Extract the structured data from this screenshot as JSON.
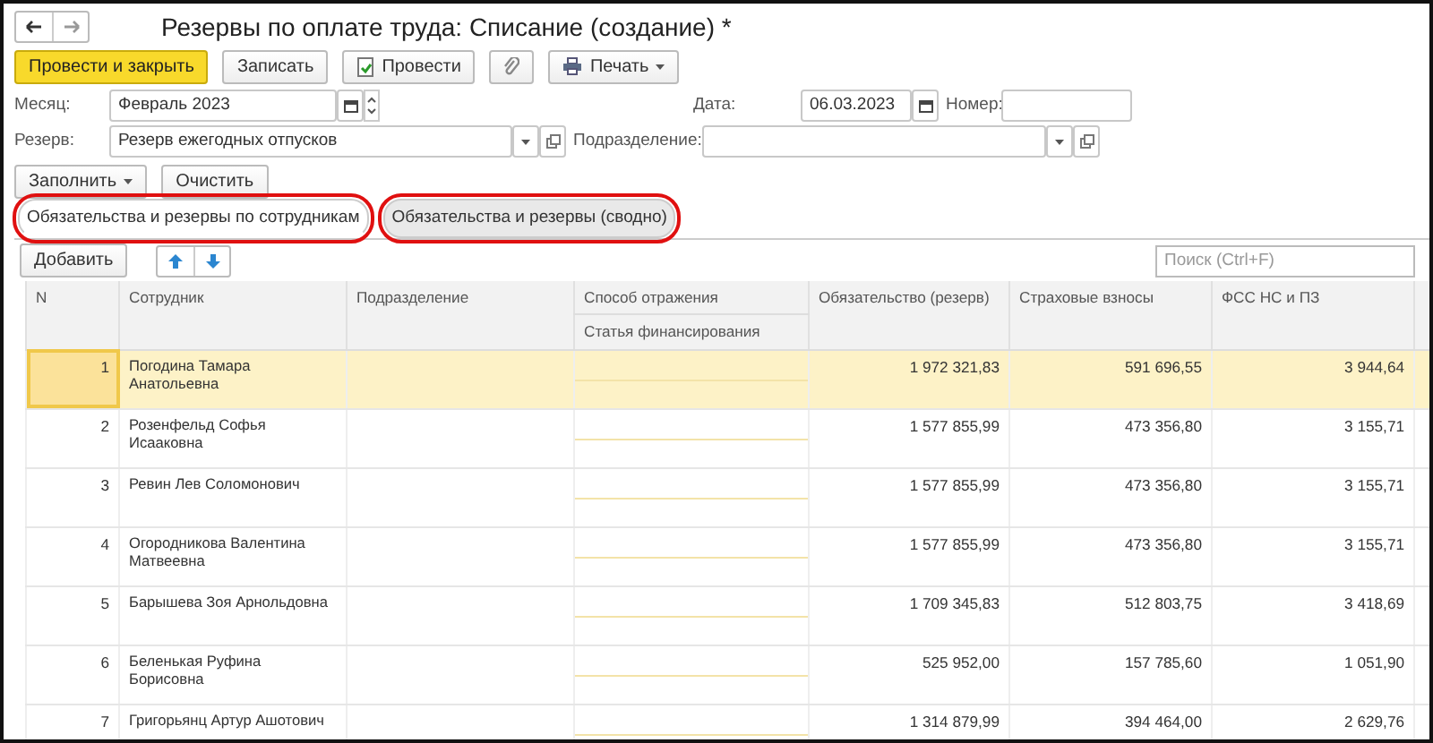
{
  "window": {
    "title": "Резервы по оплате труда: Списание (создание) *"
  },
  "toolbar": [
    {
      "label": "Провести и закрыть",
      "kind": "primary"
    },
    {
      "label": "Записать",
      "kind": "plain"
    },
    {
      "label": "Провести",
      "kind": "post"
    },
    {
      "kind": "clip"
    },
    {
      "label": "Печать",
      "kind": "print"
    }
  ],
  "fields": {
    "month": {
      "label": "Месяц:",
      "value": "Февраль 2023"
    },
    "date": {
      "label": "Дата:",
      "value": "06.03.2023"
    },
    "number": {
      "label": "Номер:"
    },
    "reserve": {
      "label": "Резерв:",
      "value": "Резерв ежегодных отпусков"
    },
    "subdivision": {
      "label": "Подразделение:"
    }
  },
  "fill_buttons": [
    {
      "label": "Заполнить",
      "dropdown": true
    },
    {
      "label": "Очистить",
      "dropdown": false
    }
  ],
  "tabs": [
    {
      "label": "Обязательства и резервы по сотрудникам",
      "selected": true,
      "highlighted": true
    },
    {
      "label": "Обязательства и резервы (сводно)",
      "selected": false,
      "highlighted": true
    }
  ],
  "table_toolbar": {
    "add": "Добавить",
    "search": {
      "placeholder": "Поиск (Ctrl+F)"
    }
  },
  "table": {
    "columns": [
      "N",
      "Сотрудник",
      "Подразделение",
      "Способ отражения",
      "Обязательство (резерв)",
      "Страховые взносы",
      "ФСС НС и ПЗ"
    ],
    "subheader": "Статья финансирования",
    "rows": [
      {
        "n": "1",
        "employee": "Погодина Тамара Анатольевна",
        "liability": "1 972 321,83",
        "insurance": "591 696,55",
        "fss": "3 944,64",
        "selected": true
      },
      {
        "n": "2",
        "employee": "Розенфельд Софья Исааковна",
        "liability": "1 577 855,99",
        "insurance": "473 356,80",
        "fss": "3 155,71",
        "selected": false
      },
      {
        "n": "3",
        "employee": "Ревин Лев Соломонович",
        "liability": "1 577 855,99",
        "insurance": "473 356,80",
        "fss": "3 155,71",
        "selected": false
      },
      {
        "n": "4",
        "employee": "Огородникова Валентина Матвеевна",
        "liability": "1 577 855,99",
        "insurance": "473 356,80",
        "fss": "3 155,71",
        "selected": false
      },
      {
        "n": "5",
        "employee": "Барышева Зоя Арнольдовна",
        "liability": "1 709 345,83",
        "insurance": "512 803,75",
        "fss": "3 418,69",
        "selected": false
      },
      {
        "n": "6",
        "employee": "Беленькая Руфина Борисовна",
        "liability": "525 952,00",
        "insurance": "157 785,60",
        "fss": "1 051,90",
        "selected": false
      },
      {
        "n": "7",
        "employee": "Григорьянц Артур Ашотович",
        "liability": "1 314 879,99",
        "insurance": "394 464,00",
        "fss": "2 629,76",
        "selected": false
      }
    ]
  }
}
